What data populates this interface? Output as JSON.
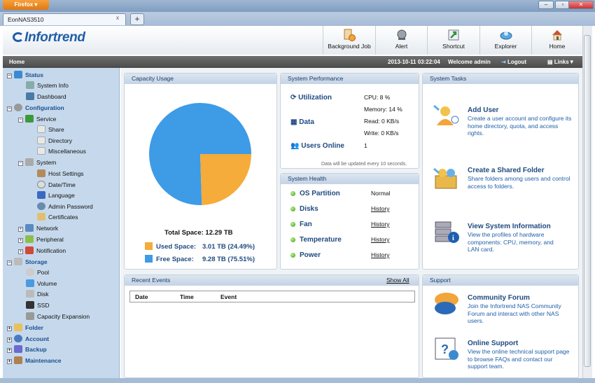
{
  "browser": {
    "menu": "Firefox",
    "tab_title": "EonNAS3510",
    "new_tab": "+",
    "tab_close": "x",
    "win_min": "–",
    "win_max": "▫",
    "win_close": "✕"
  },
  "header": {
    "logo": "Infortrend",
    "nav": [
      {
        "label": "Background Job"
      },
      {
        "label": "Alert"
      },
      {
        "label": "Shortcut"
      },
      {
        "label": "Explorer"
      },
      {
        "label": "Home"
      }
    ]
  },
  "homebar": {
    "breadcrumb": "Home",
    "datetime": "2013-10-11 03:22:04",
    "welcome": "Welcome admin",
    "logout": "Logout",
    "links": "Links▼"
  },
  "sidebar": {
    "status": "Status",
    "system_info": "System Info",
    "dashboard": "Dashboard",
    "configuration": "Configuration",
    "service": "Service",
    "share": "Share",
    "directory": "Directory",
    "misc": "Miscellaneous",
    "system": "System",
    "host_settings": "Host Settings",
    "datetime": "Date/Time",
    "language": "Language",
    "admin_password": "Admin Password",
    "certificates": "Certificates",
    "network": "Network",
    "peripheral": "Peripheral",
    "notification": "Notification",
    "storage": "Storage",
    "pool": "Pool",
    "volume": "Volume",
    "disk": "Disk",
    "ssd": "SSD",
    "capacity_expansion": "Capacity Expansion",
    "folder": "Folder",
    "account": "Account",
    "backup": "Backup",
    "maintenance": "Maintenance"
  },
  "capacity": {
    "title": "Capacity Usage",
    "total": "Total Space: 12.29 TB",
    "used_label": "Used Space:",
    "used_value": "3.01 TB (24.49%)",
    "free_label": "Free Space:",
    "free_value": "9.28 TB (75.51%)",
    "used_pct": 24.49,
    "free_pct": 75.51,
    "used_color": "#f5ac3a",
    "free_color": "#3e9be6"
  },
  "performance": {
    "title": "System Performance",
    "utilization": "Utilization",
    "cpu": "CPU: 8 %",
    "memory": "Memory: 14 %",
    "data": "Data",
    "read": "Read: 0 KB/s",
    "write": "Write: 0 KB/s",
    "users_online": "Users Online",
    "users_value": "1",
    "note": "Data will be updated every 10 seconds."
  },
  "health": {
    "title": "System Health",
    "rows": [
      {
        "label": "OS Partition",
        "value": "Normal"
      },
      {
        "label": "Disks",
        "value": "History"
      },
      {
        "label": "Fan",
        "value": "History"
      },
      {
        "label": "Temperature",
        "value": "History"
      },
      {
        "label": "Power",
        "value": "History"
      }
    ]
  },
  "tasks": {
    "title": "System Tasks",
    "items": [
      {
        "title": "Add User",
        "desc": "Create a user account and configure its home directory, quota, and access rights."
      },
      {
        "title": "Create a Shared Folder",
        "desc": "Share folders among users and control access to folders."
      },
      {
        "title": "View System Information",
        "desc": "View the profiles of hardware components: CPU, memory, and LAN card."
      }
    ]
  },
  "events": {
    "title": "Recent Events",
    "show_all": "Show All",
    "cols": [
      "Date",
      "Time",
      "Event"
    ]
  },
  "support": {
    "title": "Support",
    "items": [
      {
        "title": "Community Forum",
        "desc": "Join the Infortrend NAS Community Forum and interact with other NAS users."
      },
      {
        "title": "Online Support",
        "desc": "View the online technical support page to browse FAQs and contact our support team."
      }
    ]
  }
}
